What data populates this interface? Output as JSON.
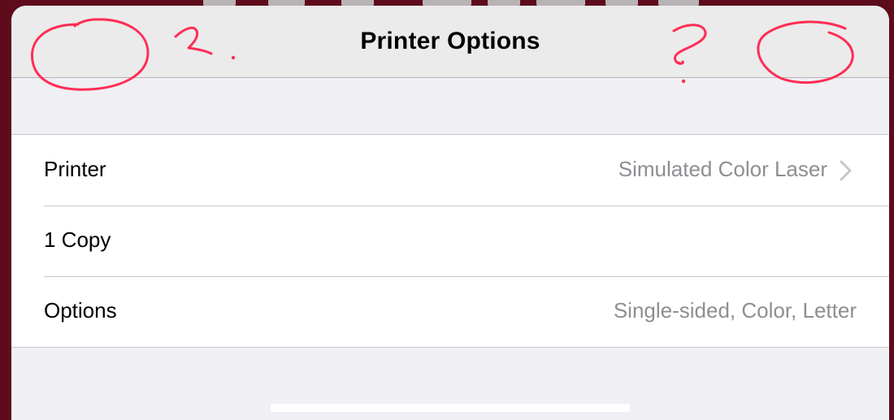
{
  "navbar": {
    "title": "Printer Options"
  },
  "rows": [
    {
      "label": "Printer",
      "value": "Simulated Color Laser",
      "chevron": true
    },
    {
      "label": "1 Copy",
      "value": "",
      "chevron": false
    },
    {
      "label": "Options",
      "value": "Single-sided, Color, Letter",
      "chevron": false
    }
  ],
  "colors": {
    "background": "#5e0b1c",
    "annotation": "#ff2d55",
    "secondary_text": "#8e8e93"
  }
}
